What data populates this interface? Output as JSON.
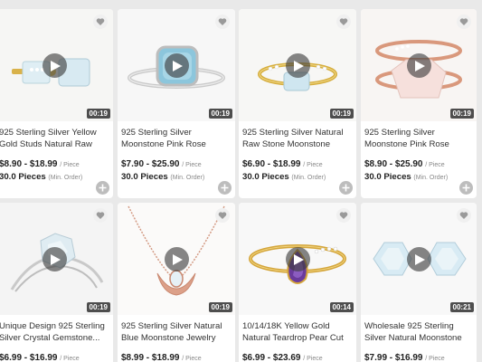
{
  "products": [
    {
      "title": "925 Sterling Silver Yellow Gold Studs Natural Raw Gemstone...",
      "price": "$8.90 - $18.99",
      "price_unit": "/ Piece",
      "moq": "30.0 Pieces",
      "moq_note": "(Min. Order)",
      "duration": "00:19",
      "image": "gold-stud-earrings-raw-moonstone"
    },
    {
      "title": "925 Sterling Silver Moonstone Pink Rose Quartz Blue Raw...",
      "price": "$7.90 - $25.90",
      "price_unit": "/ Piece",
      "moq": "30.0 Pieces",
      "moq_note": "(Min. Order)",
      "duration": "00:19",
      "image": "silver-ring-blue-raw-stone"
    },
    {
      "title": "925 Sterling Silver Natural Raw Stone Moonstone Gemstone...",
      "price": "$6.90 - $18.99",
      "price_unit": "/ Piece",
      "moq": "30.0 Pieces",
      "moq_note": "(Min. Order)",
      "duration": "00:19",
      "image": "gold-ring-raw-moonstone"
    },
    {
      "title": "925 Sterling Silver Moonstone Pink Rose Quartz Raw...",
      "price": "$8.90 - $25.90",
      "price_unit": "/ Piece",
      "moq": "30.0 Pieces",
      "moq_note": "(Min. Order)",
      "duration": "00:19",
      "image": "rose-gold-open-ring-rose-quartz"
    },
    {
      "title": "Unique Design 925 Sterling Silver Crystal Gemstone...",
      "price": "$6.99 - $16.99",
      "price_unit": "/ Piece",
      "moq": "",
      "moq_note": "",
      "duration": "00:19",
      "image": "silver-ring-raw-crystal"
    },
    {
      "title": "925 Sterling Silver Natural Blue Moonstone Jewelry Raw...",
      "price": "$8.99 - $18.99",
      "price_unit": "/ Piece",
      "moq": "",
      "moq_note": "",
      "duration": "00:19",
      "image": "rose-gold-crescent-necklace"
    },
    {
      "title": "10/14/18K Yellow Gold Natural Teardrop Pear Cut Amethyst...",
      "price": "$6.99 - $23.69",
      "price_unit": "/ Piece",
      "moq": "",
      "moq_note": "",
      "duration": "00:14",
      "image": "gold-ring-amethyst-pear"
    },
    {
      "title": "Wholesale 925 Sterling Silver Natural Moonstone Earrings...",
      "price": "$7.99 - $16.99",
      "price_unit": "/ Piece",
      "moq": "",
      "moq_note": "",
      "duration": "00:21",
      "image": "raw-moonstone-crystals"
    }
  ],
  "icons": {
    "favorite": "heart-icon",
    "play": "play-icon",
    "add": "plus-icon"
  },
  "colors": {
    "background": "#e9e9e9",
    "card": "#ffffff",
    "text": "#222222",
    "muted": "#888888",
    "add_button": "#bdbdbd"
  }
}
